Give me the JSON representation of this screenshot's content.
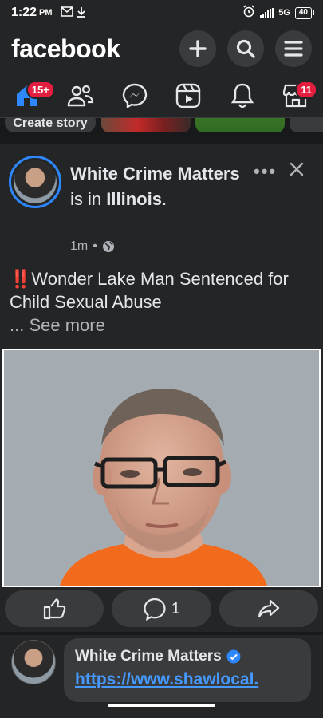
{
  "status_bar": {
    "time": "1:22",
    "ampm": "PM",
    "network": "5G",
    "battery": "40"
  },
  "header": {
    "logo": "facebook"
  },
  "nav": {
    "items": [
      {
        "name": "home",
        "badge": "15+"
      },
      {
        "name": "friends",
        "badge": ""
      },
      {
        "name": "messenger",
        "badge": ""
      },
      {
        "name": "watch",
        "badge": ""
      },
      {
        "name": "notifications",
        "badge": ""
      },
      {
        "name": "marketplace",
        "badge": "11"
      }
    ]
  },
  "stories": {
    "create_label": "Create story"
  },
  "post": {
    "author": "White Crime Matters",
    "is_in": " is in ",
    "location": "Illinois",
    "period": ".",
    "time": "1m",
    "separator": "•",
    "text": "‼️Wonder Lake Man Sentenced for Child Sexual Abuse",
    "see_more": "... See more"
  },
  "actions": {
    "comment_count": "1"
  },
  "comment": {
    "author": "White Crime Matters",
    "link": "https://www.shawlocal."
  },
  "colors": {
    "accent": "#2d88ff",
    "badge": "#e41e3f",
    "link": "#4599ff",
    "background": "#242526"
  }
}
